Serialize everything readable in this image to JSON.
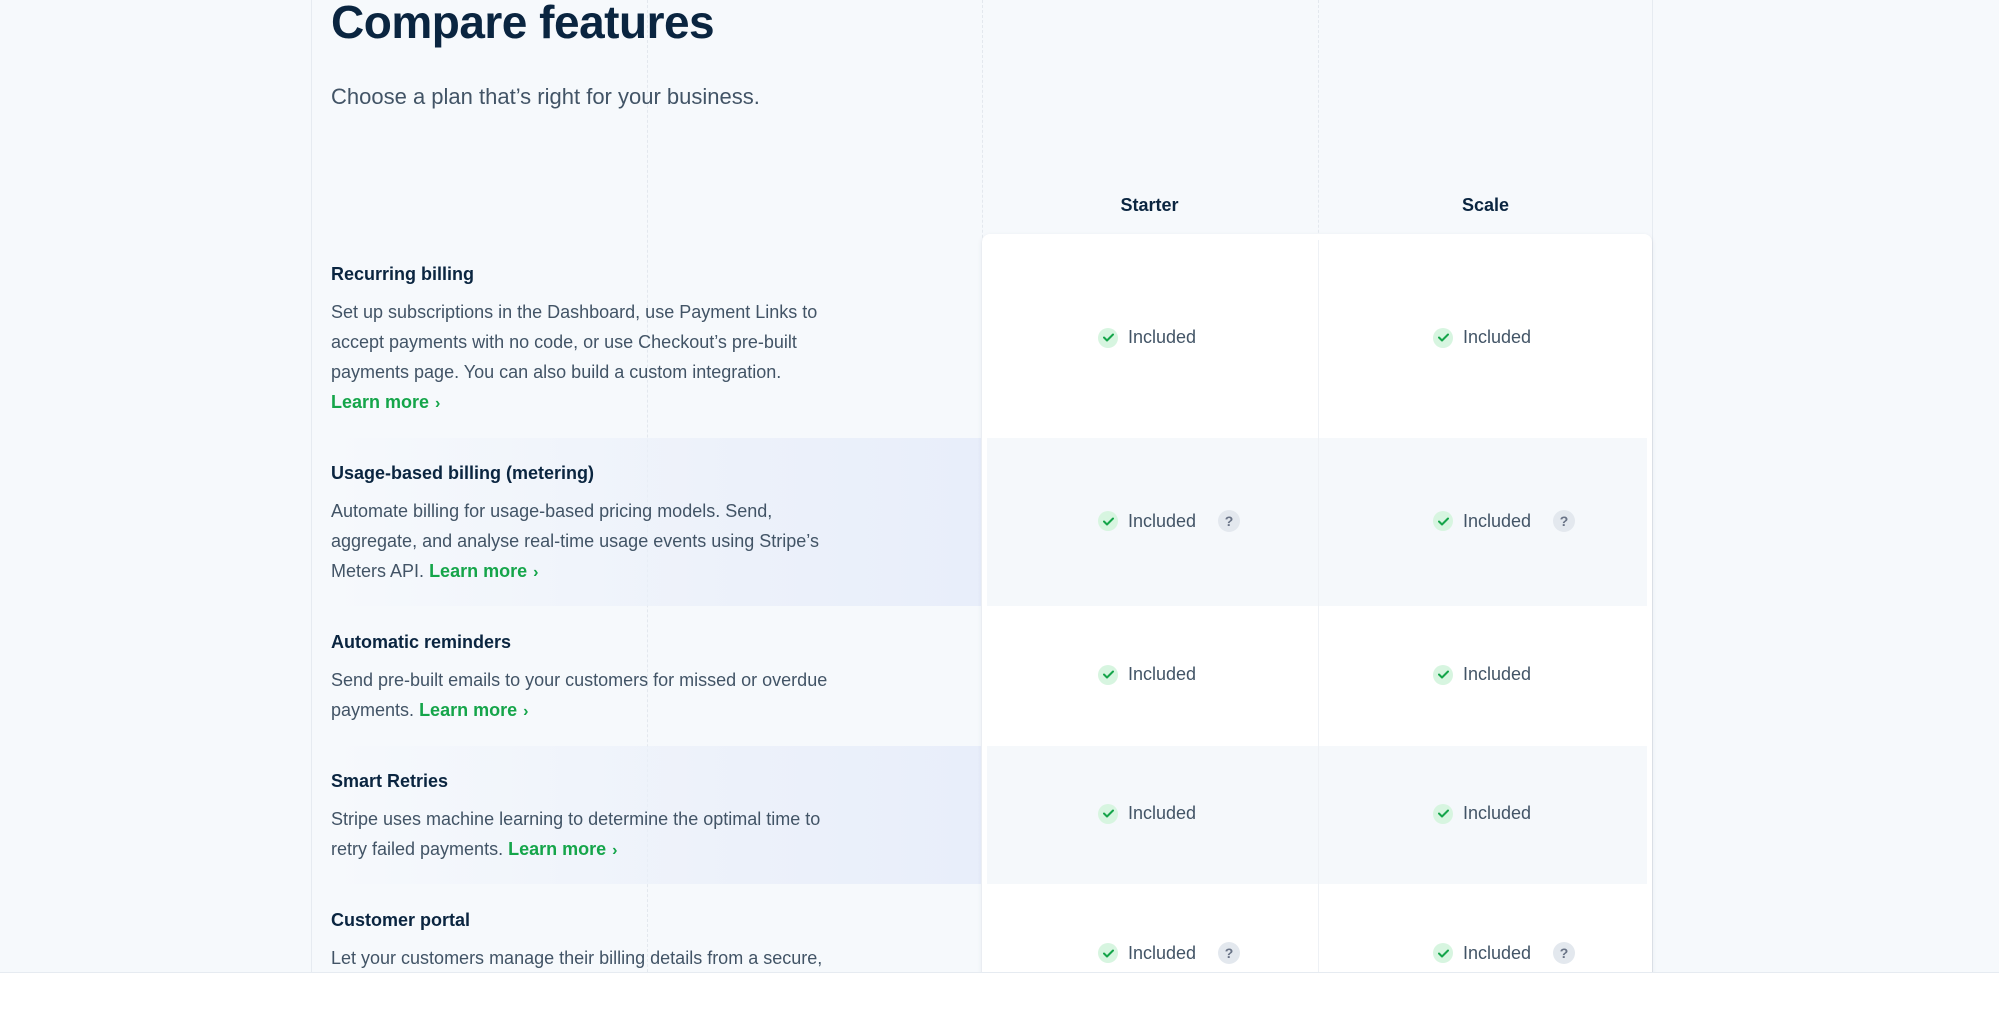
{
  "header": {
    "title": "Compare features",
    "subtitle": "Choose a plan that’s right for your business."
  },
  "plans": [
    "Starter",
    "Scale"
  ],
  "learn_more_label": "Learn more",
  "included_label": "Included",
  "help_glyph": "?",
  "icons": {
    "check": "check-circle-icon",
    "help": "question-circle-icon",
    "chevron": "chevron-right-icon"
  },
  "colors": {
    "accent_green": "#15a54a",
    "check_bg": "#d7f5e0",
    "heading": "#0a2540",
    "body_text": "#425466"
  },
  "features": [
    {
      "title": "Recurring billing",
      "description": "Set up subscriptions in the Dashboard, use Payment Links to accept payments with no code, or use Checkout’s pre-built payments page. You can also build a custom integration.",
      "starter": "Included",
      "scale": "Included",
      "has_help": false
    },
    {
      "title": "Usage-based billing (metering)",
      "description": "Automate billing for usage-based pricing models. Send, aggregate, and analyse real-time usage events using Stripe’s Meters API.",
      "starter": "Included",
      "scale": "Included",
      "has_help": true
    },
    {
      "title": "Automatic reminders",
      "description": "Send pre-built emails to your customers for missed or overdue payments.",
      "starter": "Included",
      "scale": "Included",
      "has_help": false
    },
    {
      "title": "Smart Retries",
      "description": "Stripe uses machine learning to determine the optimal time to retry failed payments.",
      "starter": "Included",
      "scale": "Included",
      "has_help": false
    },
    {
      "title": "Customer portal",
      "description": "Let your customers manage their billing details from a secure,",
      "starter": "Included",
      "scale": "Included",
      "has_help": true
    }
  ]
}
